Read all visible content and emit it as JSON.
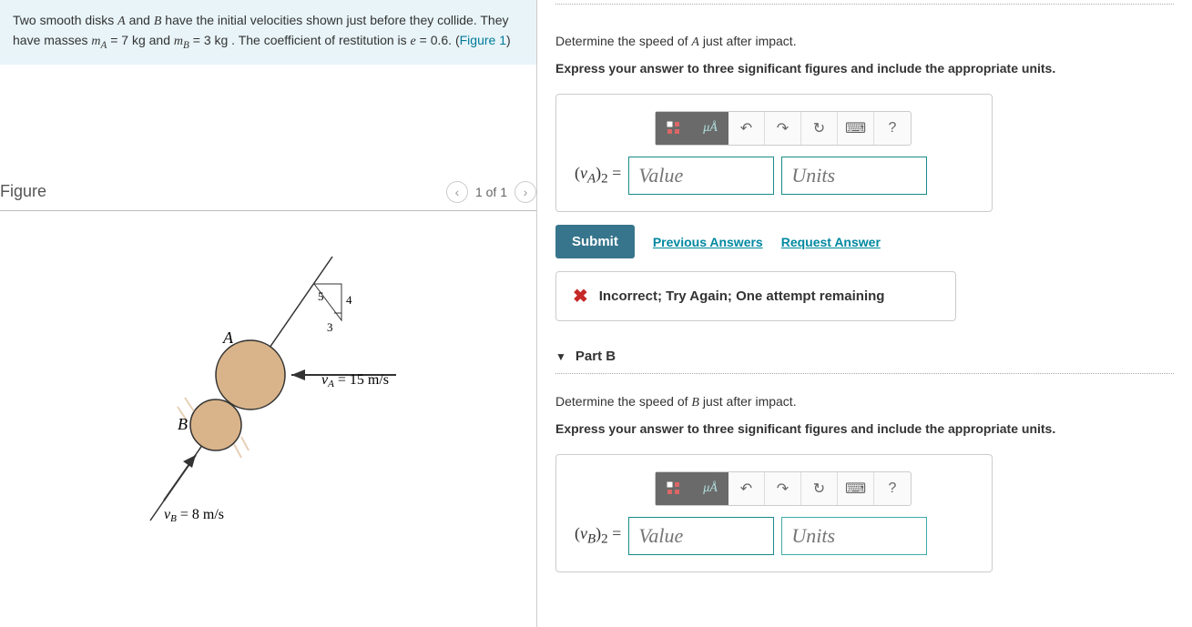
{
  "problem": {
    "text_prefix": "Two smooth disks ",
    "A": "A",
    "middle1": " and ",
    "B": "B",
    "middle2": " have the initial velocities shown just before they collide. They have masses ",
    "mA_sym": "m",
    "mA_sub": "A",
    "mA_eq": " = 7  kg and ",
    "mB_sym": "m",
    "mB_sub": "B",
    "mB_eq": " = 3  kg . The coefficient of restitution is ",
    "e_sym": "e",
    "e_eq": " = 0.6. (",
    "fig_link": "Figure 1",
    "close": ")"
  },
  "figure": {
    "title": "Figure",
    "counter": "1 of 1",
    "labels": {
      "A": "A",
      "B": "B",
      "vA": "vA = 15 m/s",
      "vB": "vB = 8 m/s",
      "tri_5": "5",
      "tri_4": "4",
      "tri_3": "3"
    }
  },
  "partA": {
    "question": "Determine the speed of ",
    "subject": "A",
    "question_end": " just after impact.",
    "instruction": "Express your answer to three significant figures and include the appropriate units.",
    "label": "(vA)2 = ",
    "value_ph": "Value",
    "units_ph": "Units",
    "submit": "Submit",
    "prev": "Previous Answers",
    "req": "Request Answer",
    "feedback": "Incorrect; Try Again; One attempt remaining",
    "toolbar_mu": "μÅ"
  },
  "partB": {
    "header": "Part B",
    "question": "Determine the speed of ",
    "subject": "B",
    "question_end": " just after impact.",
    "instruction": "Express your answer to three significant figures and include the appropriate units.",
    "label": "(vB)2 = ",
    "value_ph": "Value",
    "units_ph": "Units",
    "toolbar_mu": "μÅ"
  }
}
